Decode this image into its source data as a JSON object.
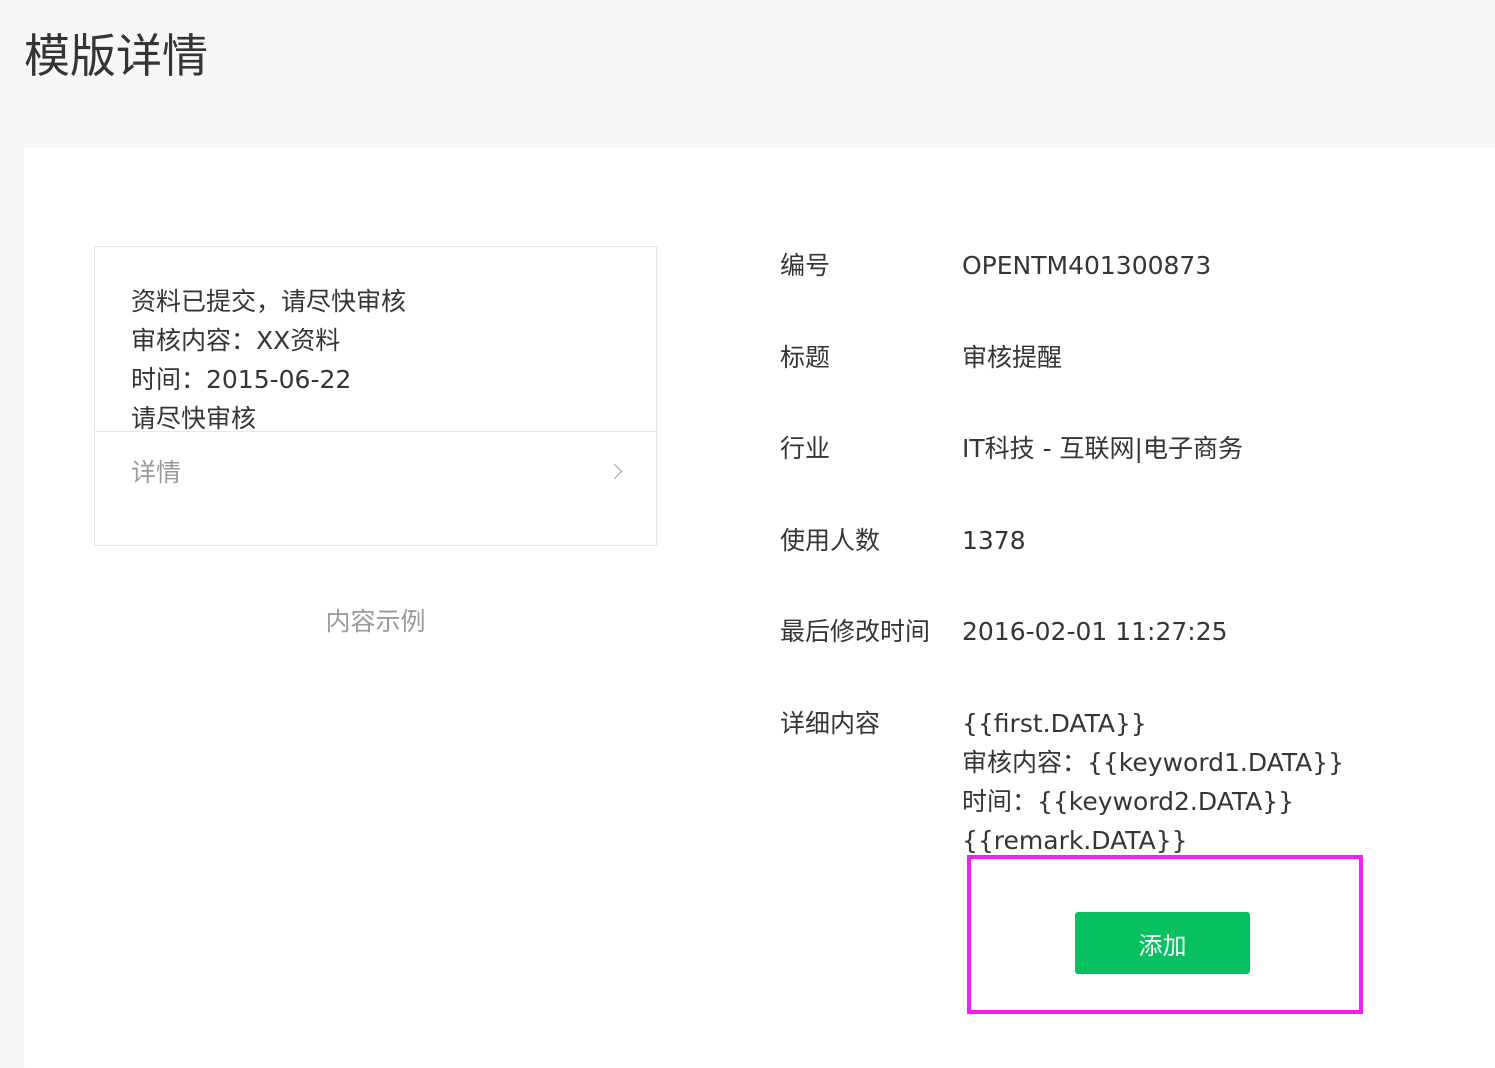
{
  "page_title": "模版详情",
  "preview": {
    "lines": [
      "资料已提交，请尽快审核",
      "审核内容：XX资料",
      "时间：2015-06-22",
      "请尽快审核"
    ],
    "footer_label": "详情",
    "caption": "内容示例"
  },
  "info": {
    "id": {
      "label": "编号",
      "value": "OPENTM401300873"
    },
    "title": {
      "label": "标题",
      "value": "审核提醒"
    },
    "industry": {
      "label": "行业",
      "value": "IT科技 - 互联网|电子商务"
    },
    "users": {
      "label": "使用人数",
      "value": "1378"
    },
    "modified": {
      "label": "最后修改时间",
      "value": "2016-02-01 11:27:25"
    },
    "detail": {
      "label": "详细内容",
      "lines": [
        "{{first.DATA}}",
        "审核内容：{{keyword1.DATA}}",
        "时间：{{keyword2.DATA}}",
        "{{remark.DATA}}"
      ]
    }
  },
  "add_button_label": "添加",
  "colors": {
    "primary": "#07c160",
    "highlight": "#f021f0",
    "background": "#f6f7f9"
  },
  "icons": {
    "detail_arrow": "chevron-right-icon"
  }
}
